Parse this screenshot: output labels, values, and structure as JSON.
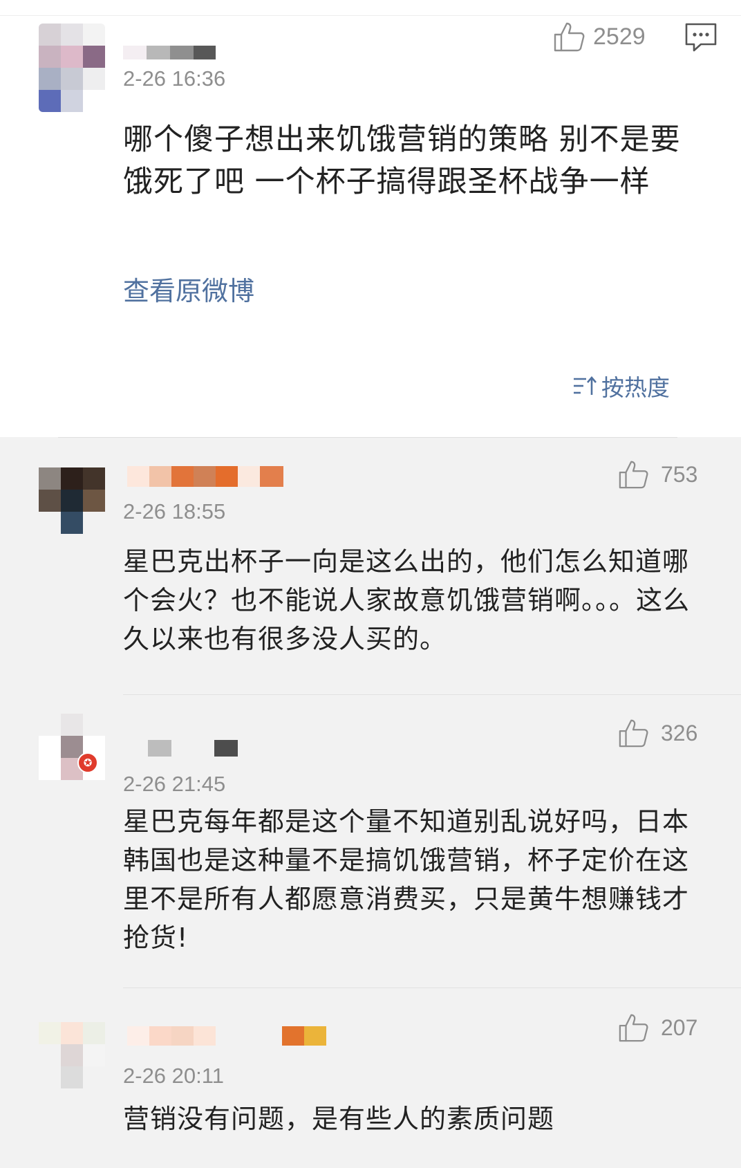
{
  "main_post": {
    "time": "2-26 16:36",
    "likes": "2529",
    "text": "哪个傻子想出来饥饿营销的策略 别不是要饿死了吧 一个杯子搞得跟圣杯战争一样",
    "view_original": "查看原微博",
    "sort_label": "按热度",
    "sort_icon": "sort-desc-icon",
    "comment_icon": "comment-icon",
    "like_icon": "thumbs-up-icon"
  },
  "comments": [
    {
      "time": "2-26 18:55",
      "likes": "753",
      "text": "星巴克出杯子一向是这么出的，他们怎么知道哪个会火？也不能说人家故意饥饿营销啊。。。这么久以来也有很多没人买的。"
    },
    {
      "time": "2-26 21:45",
      "likes": "326",
      "text": "星巴克每年都是这个量不知道别乱说好吗，日本韩国也是这种量不是搞饥饿营销，杯子定价在这里不是所有人都愿意消费买，只是黄牛想赚钱才抢货!",
      "badge_icon": "verified-badge-icon"
    },
    {
      "time": "2-26 20:11",
      "likes": "207",
      "text": "营销没有问题，是有些人的素质问题"
    }
  ],
  "colors": {
    "link": "#50719f",
    "meta": "#8e8e8e",
    "text": "#222222",
    "comments_bg": "#f2f2f2",
    "badge": "#e03b2c"
  }
}
